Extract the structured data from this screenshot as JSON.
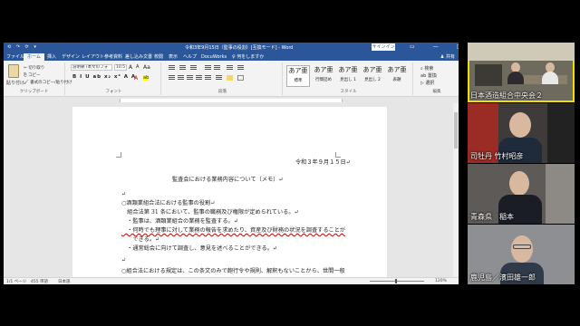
{
  "word": {
    "quick_access": "⟲ ↷ ⟳ ▾",
    "title": "令和3年9月15日（監事の役割）[互換モード] - Word",
    "search_hint": "♀ 何をしますか",
    "signin": "サインイン",
    "window_controls": "▭ — ▢ ✕",
    "tabs": [
      "ファイル",
      "ホーム",
      "挿入",
      "デザイン",
      "レイアウト",
      "参考資料",
      "差し込み文書",
      "校閲",
      "表示",
      "ヘルプ",
      "DocuWorks",
      "♀ 何をしますか"
    ],
    "share": "♟ 共有",
    "ribbon": {
      "paste": "貼り付け",
      "clipboard_items": [
        "✂ 切り取り",
        "⎘ コピー",
        "🖌 書式のコピー/貼り付け"
      ],
      "clipboard_label": "クリップボード",
      "font_name": "游明朝 (本文のフォ",
      "font_size": "10.5",
      "font_buttons": "B  I  U  ab  x₂  x²  A  A",
      "font_label": "フォント",
      "paragraph_label": "段落",
      "styles": [
        {
          "glyph": "あア亜",
          "name": "標準"
        },
        {
          "glyph": "あア亜",
          "name": "行間詰め"
        },
        {
          "glyph": "あア亜",
          "name": "見出し 1"
        },
        {
          "glyph": "あア亜",
          "name": "見出し 2"
        },
        {
          "glyph": "あア亜",
          "name": "表題"
        }
      ],
      "styles_label": "スタイル",
      "editing": [
        "⌕ 検索",
        "ab 置換",
        "▷ 選択"
      ],
      "editing_label": "編集"
    },
    "document": {
      "date": "令和３年９月１５日↵",
      "title": "監査会における業務内容について（メモ）↵",
      "lines": [
        "↵",
        "○酒類業組合法における監事の役割↵",
        "　組合法第 31 条において、監事の職務及び権限が定められている。↵",
        "　・監事は、酒類業組合の業務を監査する。↵",
        "　・何時でも理事に対して業務の報告を求めたり、資産及び財務の状況を調査することが",
        "　　できる。↵",
        "　・通常総会に向けて調査し、意見を述べることができる。↵",
        "↵",
        "○組合法における規定は、この条文のみで飽行令や規則、解釈もないことから、世間一般"
      ]
    },
    "status": {
      "page": "1/1 ページ",
      "words": "455 単語",
      "lang": "日本語",
      "zoom": "120%"
    }
  },
  "participants": [
    {
      "name": "日本酒造組合中央会２",
      "active": true
    },
    {
      "name": "司牡丹 竹村昭彦",
      "active": false
    },
    {
      "name": "青森県　稲本",
      "active": false
    },
    {
      "name": "鹿児島／濱田雄一郎",
      "active": false
    }
  ],
  "colors": {
    "word_blue": "#2b579a",
    "active_speaker": "#f0e000"
  }
}
